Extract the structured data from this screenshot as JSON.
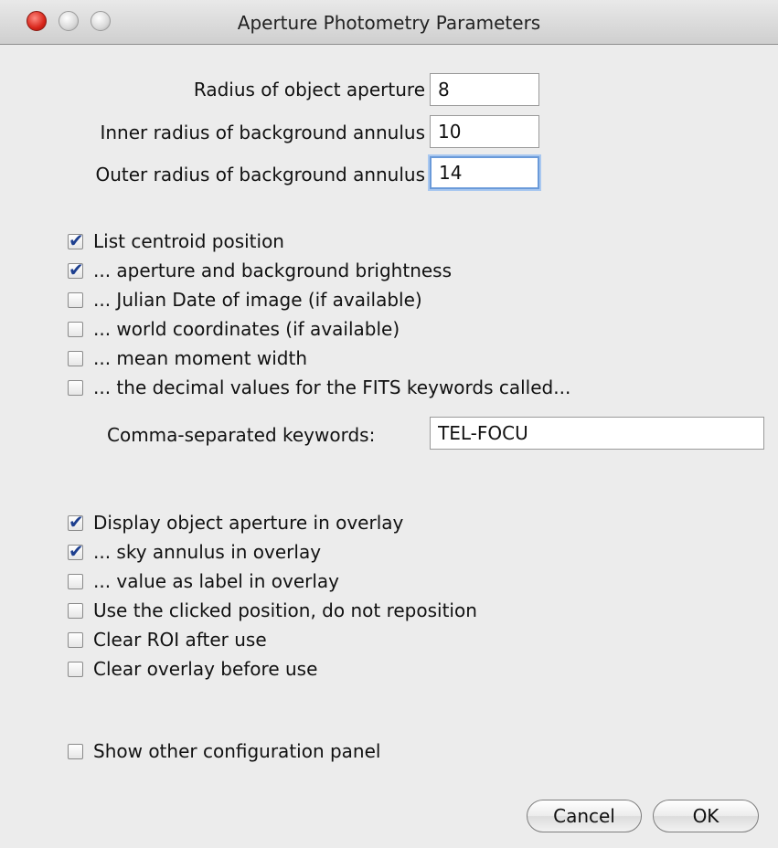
{
  "window": {
    "title": "Aperture Photometry Parameters"
  },
  "fields": [
    {
      "label": "Radius of object aperture",
      "value": "8"
    },
    {
      "label": "Inner radius of background annulus",
      "value": "10"
    },
    {
      "label": "Outer radius of background annulus",
      "value": "14"
    }
  ],
  "measurements": [
    {
      "label": "List centroid position",
      "checked": true
    },
    {
      "label": "... aperture and background brightness",
      "checked": true
    },
    {
      "label": "... Julian Date of image (if available)",
      "checked": false
    },
    {
      "label": "... world coordinates (if available)",
      "checked": false
    },
    {
      "label": "... mean moment width",
      "checked": false
    },
    {
      "label": "... the decimal values for the FITS keywords called...",
      "checked": false
    }
  ],
  "keywords": {
    "label": "Comma-separated keywords:",
    "value": "TEL-FOCU"
  },
  "overlay": [
    {
      "label": "Display object aperture in overlay",
      "checked": true
    },
    {
      "label": "... sky annulus in overlay",
      "checked": true
    },
    {
      "label": "... value as label in overlay",
      "checked": false
    },
    {
      "label": "Use the clicked position, do not reposition",
      "checked": false
    },
    {
      "label": "Clear ROI after use",
      "checked": false
    },
    {
      "label": "Clear overlay before use",
      "checked": false
    }
  ],
  "other": [
    {
      "label": "Show other configuration panel",
      "checked": false
    }
  ],
  "buttons": {
    "cancel": "Cancel",
    "ok": "OK"
  }
}
